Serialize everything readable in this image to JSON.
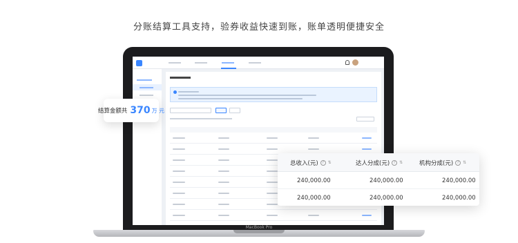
{
  "headline": "分账结算工具支持，验券收益快速到账，账单透明便捷安全",
  "device_brand": "MacBook Pro",
  "callout": {
    "prefix": "结算金额共",
    "amount": "370",
    "unit": "万 元"
  },
  "table": {
    "columns": [
      {
        "label": "总收入(元)",
        "icon": "help-circle-icon",
        "sort": true
      },
      {
        "label": "达人分成(元)",
        "icon": "help-circle-icon",
        "sort": true
      },
      {
        "label": "机构分成(元)",
        "icon": "help-circle-icon",
        "sort": true
      }
    ],
    "rows": [
      [
        "240,000.00",
        "240,000.00",
        "240,000.00"
      ],
      [
        "240,000.00",
        "240,000.00",
        "240,000.00"
      ]
    ]
  },
  "colors": {
    "accent": "#3a86ff",
    "laptop_frame": "#1c1c1e"
  }
}
